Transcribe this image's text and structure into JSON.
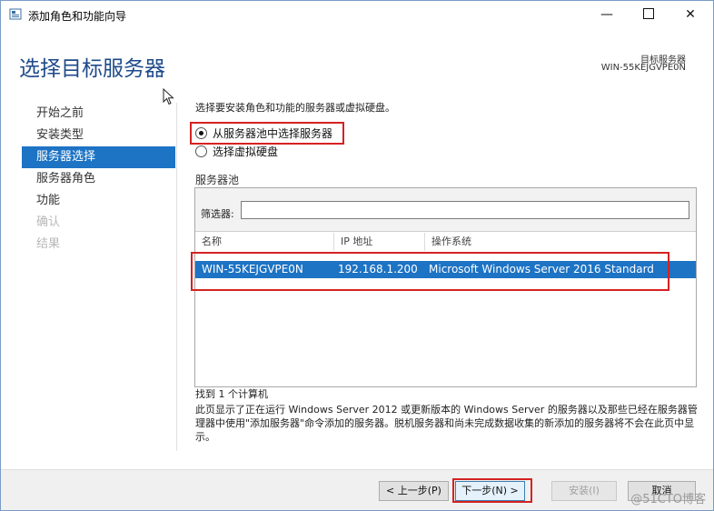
{
  "window": {
    "title": "添加角色和功能向导",
    "icon": "server-manager-icon"
  },
  "header": {
    "page_title": "选择目标服务器",
    "dest_label": "目标服务器",
    "dest_value": "WIN-55KEJGVPE0N"
  },
  "nav": {
    "items": [
      {
        "label": "开始之前",
        "state": "normal"
      },
      {
        "label": "安装类型",
        "state": "normal"
      },
      {
        "label": "服务器选择",
        "state": "active"
      },
      {
        "label": "服务器角色",
        "state": "normal"
      },
      {
        "label": "功能",
        "state": "normal"
      },
      {
        "label": "确认",
        "state": "disabled"
      },
      {
        "label": "结果",
        "state": "disabled"
      }
    ]
  },
  "main": {
    "instruction": "选择要安装角色和功能的服务器或虚拟硬盘。",
    "options": [
      {
        "label": "从服务器池中选择服务器",
        "checked": true
      },
      {
        "label": "选择虚拟硬盘",
        "checked": false
      }
    ],
    "pool": {
      "label": "服务器池",
      "filter_label": "筛选器:",
      "filter_value": "",
      "columns": [
        "名称",
        "IP 地址",
        "操作系统"
      ],
      "rows": [
        {
          "name": "WIN-55KEJGVPE0N",
          "ip": "192.168.1.200",
          "os": "Microsoft Windows Server 2016 Standard"
        }
      ]
    },
    "found": "找到 1 个计算机",
    "description": "此页显示了正在运行 Windows Server 2012 或更新版本的 Windows Server 的服务器以及那些已经在服务器管理器中使用\"添加服务器\"命令添加的服务器。脱机服务器和尚未完成数据收集的新添加的服务器将不会在此页中显示。"
  },
  "footer": {
    "prev": "< 上一步(P)",
    "next": "下一步(N) >",
    "install": "安装(I)",
    "cancel": "取消"
  },
  "watermark": "@51CTO博客",
  "colors": {
    "accent": "#1d73c4",
    "title": "#1e4a8a",
    "highlight_box": "#d52222"
  }
}
